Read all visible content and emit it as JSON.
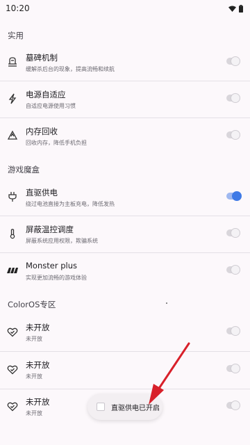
{
  "status_bar": {
    "time": "10:20"
  },
  "sections": [
    {
      "title": "实用",
      "items": [
        {
          "icon": "stele-icon",
          "title": "墓碑机制",
          "desc": "缓解杀后台的现象，提高流畅和续航",
          "enabled": false
        },
        {
          "icon": "lightning-icon",
          "title": "电源自适应",
          "desc": "自适应电源使用习惯",
          "enabled": false
        },
        {
          "icon": "recycle-icon",
          "title": "内存回收",
          "desc": "回收内存，降低手机负担",
          "enabled": false
        }
      ]
    },
    {
      "title": "游戏魔盒",
      "items": [
        {
          "icon": "plug-icon",
          "title": "直驱供电",
          "desc": "绕过电池直接为主板充电，降低发热",
          "enabled": true
        },
        {
          "icon": "thermometer-icon",
          "title": "屏蔽温控调度",
          "desc": "屏蔽系统应用权限，欺骗系统",
          "enabled": false
        },
        {
          "icon": "monster-logo-icon",
          "title": "Monster plus",
          "desc": "实现更加流畅的游戏体验",
          "enabled": false
        }
      ]
    },
    {
      "title": "ColorOS专区",
      "items": [
        {
          "icon": "heart-check-icon",
          "title": "未开放",
          "desc": "未开放",
          "enabled": false
        },
        {
          "icon": "heart-check-icon",
          "title": "未开放",
          "desc": "未开放",
          "enabled": false
        },
        {
          "icon": "heart-check-icon",
          "title": "未开放",
          "desc": "未开放",
          "enabled": false
        }
      ]
    }
  ],
  "toast": {
    "message": "直驱供电已开启"
  },
  "colors": {
    "accent": "#3f7ae6",
    "arrow": "#d8202a",
    "background": "#fcf8fb"
  }
}
